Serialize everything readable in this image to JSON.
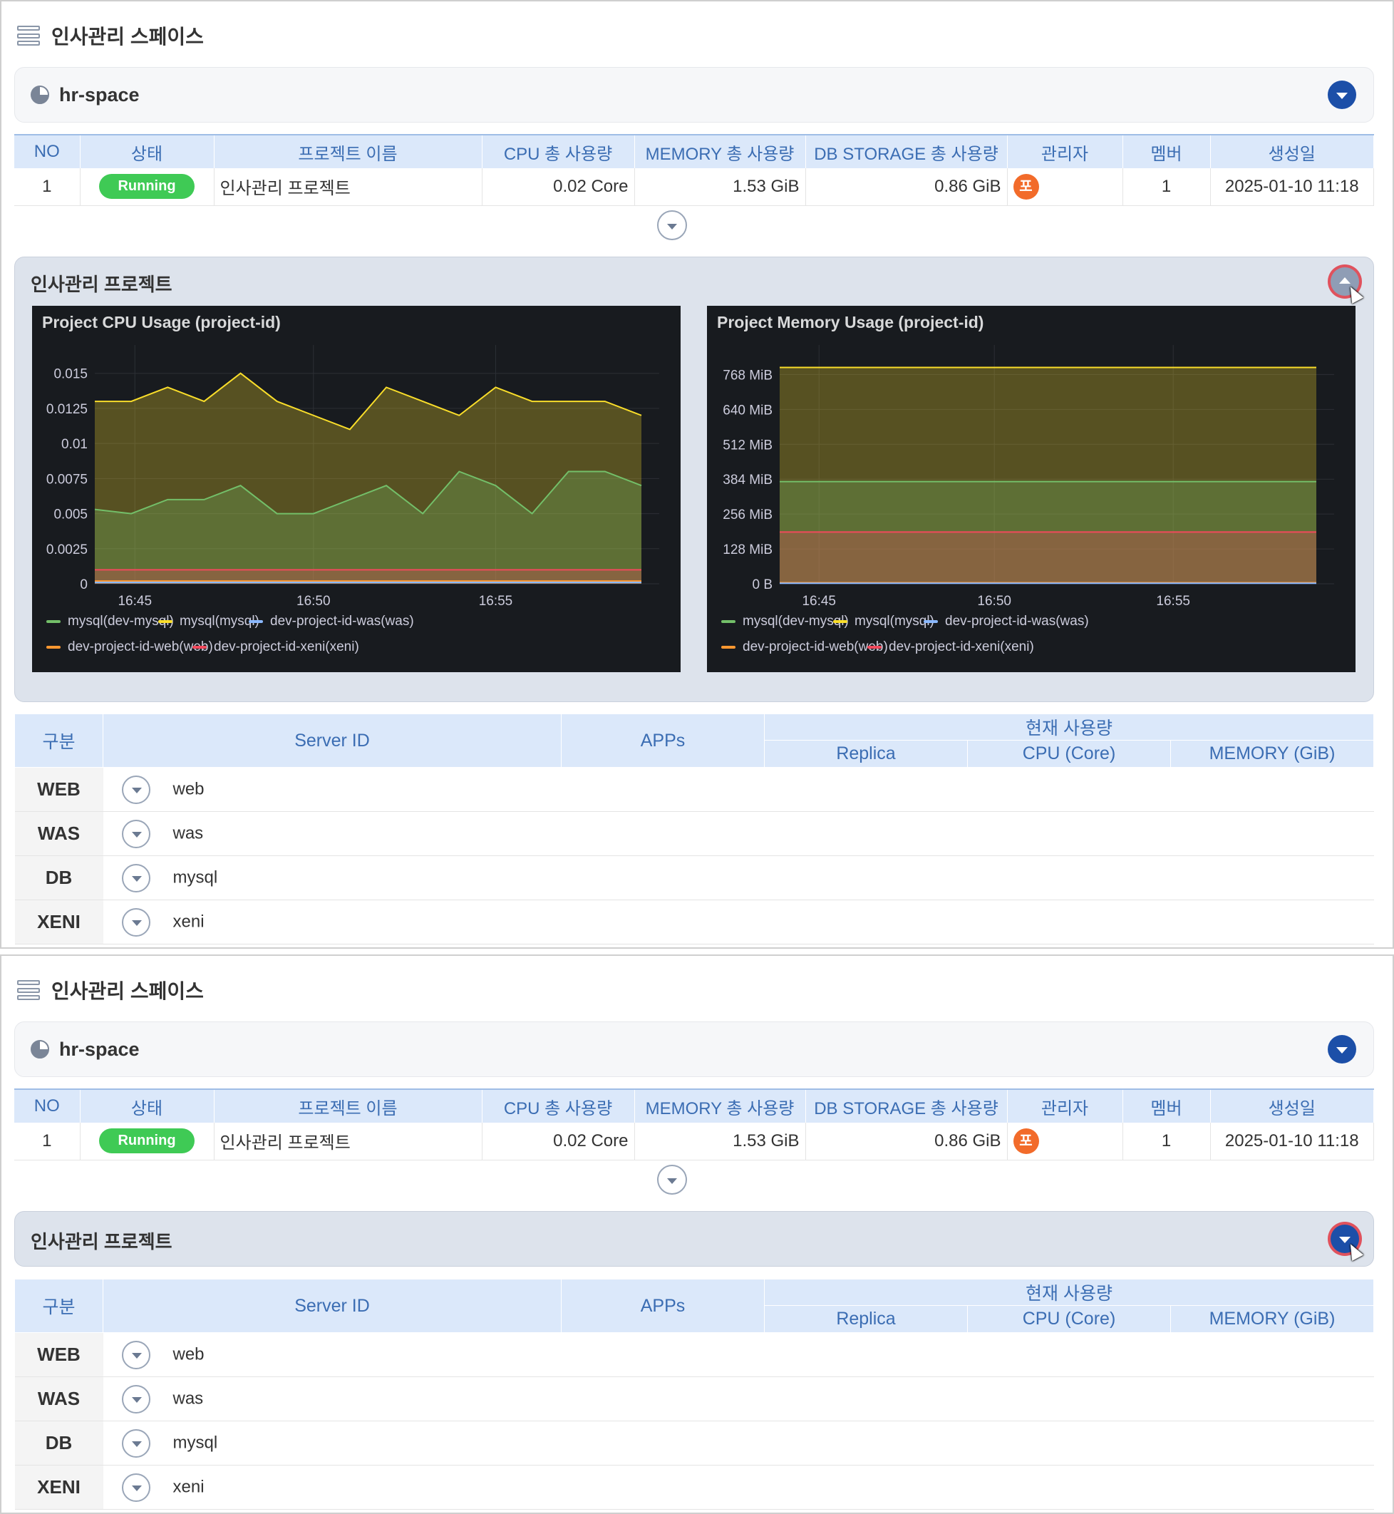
{
  "page": {
    "title": "인사관리 스페이스",
    "space_name": "hr-space"
  },
  "project_table": {
    "headers": [
      "NO",
      "상태",
      "프로젝트 이름",
      "CPU 총 사용량",
      "MEMORY 총 사용량",
      "DB STORAGE 총 사용량",
      "관리자",
      "멤버",
      "생성일"
    ],
    "row": {
      "no": "1",
      "status": "Running",
      "name": "인사관리 프로젝트",
      "cpu": "0.02 Core",
      "memory": "1.53 GiB",
      "db_storage": "0.86 GiB",
      "admin_initial": "포",
      "members": "1",
      "created": "2025-01-10 11:18"
    }
  },
  "project_panel": {
    "title": "인사관리 프로젝트"
  },
  "colors": {
    "mysql_dev": "#73bf69",
    "mysql": "#fade2a",
    "was": "#8ab8ff",
    "web": "#ff9830",
    "xeni": "#f2495c",
    "accent": "#1c4fa8",
    "running": "#3fca55",
    "avatar": "#f26b2a"
  },
  "chart_data": [
    {
      "type": "area",
      "title": "Project CPU Usage (project-id)",
      "x_ticks": [
        "16:45",
        "16:50",
        "16:55"
      ],
      "y_ticks": [
        "0",
        "0.0025",
        "0.005",
        "0.0075",
        "0.01",
        "0.0125",
        "0.015"
      ],
      "ylim": [
        0,
        0.016
      ],
      "x": [
        0,
        1,
        2,
        3,
        4,
        5,
        6,
        7,
        8,
        9,
        10,
        11,
        12,
        13,
        14,
        15
      ],
      "legend": "bottom",
      "series": [
        {
          "name": "mysql(dev-mysql)",
          "color": "#73bf69",
          "values": [
            0.0053,
            0.005,
            0.006,
            0.006,
            0.007,
            0.005,
            0.005,
            0.006,
            0.007,
            0.005,
            0.008,
            0.007,
            0.005,
            0.008,
            0.008,
            0.007
          ]
        },
        {
          "name": "mysql(mysql)",
          "color": "#fade2a",
          "values": [
            0.013,
            0.013,
            0.014,
            0.013,
            0.015,
            0.013,
            0.012,
            0.011,
            0.014,
            0.013,
            0.012,
            0.014,
            0.013,
            0.013,
            0.013,
            0.012
          ]
        },
        {
          "name": "dev-project-id-was(was)",
          "color": "#8ab8ff",
          "values": [
            0.0001,
            0.0001,
            0.0001,
            0.0001,
            0.0001,
            0.0001,
            0.0001,
            0.0001,
            0.0001,
            0.0001,
            0.0001,
            0.0001,
            0.0001,
            0.0001,
            0.0001,
            0.0001
          ]
        },
        {
          "name": "dev-project-id-web(web)",
          "color": "#ff9830",
          "values": [
            0.0002,
            0.0002,
            0.0002,
            0.0002,
            0.0002,
            0.0002,
            0.0002,
            0.0002,
            0.0002,
            0.0002,
            0.0002,
            0.0002,
            0.0002,
            0.0002,
            0.0002,
            0.0002
          ]
        },
        {
          "name": "dev-project-id-xeni(xeni)",
          "color": "#f2495c",
          "values": [
            0.001,
            0.001,
            0.001,
            0.001,
            0.001,
            0.001,
            0.001,
            0.001,
            0.001,
            0.001,
            0.001,
            0.001,
            0.001,
            0.001,
            0.001,
            0.001
          ]
        }
      ]
    },
    {
      "type": "area",
      "title": "Project Memory Usage (project-id)",
      "x_ticks": [
        "16:45",
        "16:50",
        "16:55"
      ],
      "y_ticks": [
        "0 B",
        "128 MiB",
        "256 MiB",
        "384 MiB",
        "512 MiB",
        "640 MiB",
        "768 MiB"
      ],
      "ylim": [
        0,
        824
      ],
      "x": [
        0,
        15
      ],
      "legend": "bottom",
      "series": [
        {
          "name": "mysql(dev-mysql)",
          "color": "#73bf69",
          "values": [
            375,
            375
          ]
        },
        {
          "name": "mysql(mysql)",
          "color": "#fade2a",
          "values": [
            794,
            794
          ]
        },
        {
          "name": "dev-project-id-was(was)",
          "color": "#8ab8ff",
          "values": [
            2,
            2
          ]
        },
        {
          "name": "dev-project-id-web(web)",
          "color": "#ff9830",
          "values": [
            4,
            4
          ]
        },
        {
          "name": "dev-project-id-xeni(xeni)",
          "color": "#f2495c",
          "values": [
            190,
            190
          ]
        }
      ]
    }
  ],
  "server_table": {
    "headers": {
      "category": "구분",
      "server_id": "Server ID",
      "apps": "APPs",
      "usage": "현재 사용량",
      "replica": "Replica",
      "cpu": "CPU (Core)",
      "memory": "MEMORY (GiB)"
    },
    "rows": [
      {
        "category": "WEB",
        "server_id": "web"
      },
      {
        "category": "WAS",
        "server_id": "was"
      },
      {
        "category": "DB",
        "server_id": "mysql"
      },
      {
        "category": "XENI",
        "server_id": "xeni"
      }
    ]
  }
}
